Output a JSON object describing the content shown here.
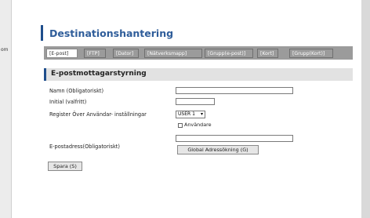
{
  "left_edge_label": "om",
  "page": {
    "title": "Destinationshantering"
  },
  "tabs": [
    {
      "label": "[E-post]",
      "active": true
    },
    {
      "label": "[FTP]"
    },
    {
      "label": "[Dator]"
    },
    {
      "label": "[Nätverksmapp]"
    },
    {
      "label": "[Grupp(e-post)]"
    },
    {
      "label": "[Kort]"
    },
    {
      "label": "[Grupp(Kort)]"
    }
  ],
  "section": {
    "title": "E-postmottagarstyrning"
  },
  "form": {
    "name_label": "Namn (Obligatoriskt)",
    "name_value": "",
    "initial_label": "Initial (valfritt)",
    "initial_value": "",
    "register_label": "Register Över Användar- inställningar",
    "register_select_value": "USER 1",
    "users_checkbox_label": "Användare",
    "email_label": "E-postadress(Obligatoriskt)",
    "email_value": "",
    "global_search_button": "Global Adressökning (G)",
    "save_button": "Spara (S)"
  }
}
